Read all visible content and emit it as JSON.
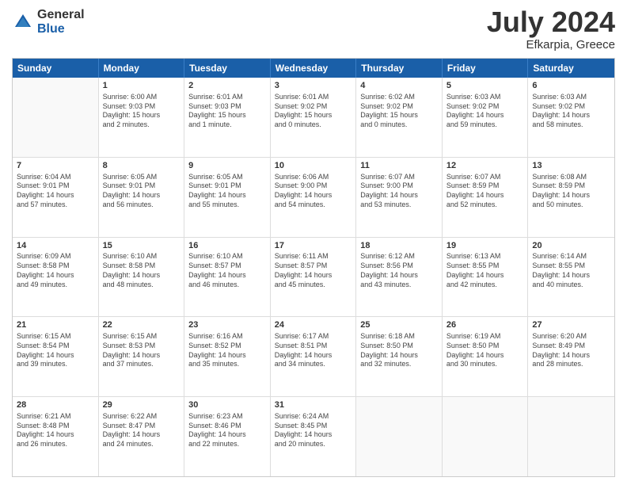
{
  "logo": {
    "general": "General",
    "blue": "Blue"
  },
  "title": {
    "month": "July 2024",
    "location": "Efkarpia, Greece"
  },
  "header": {
    "days": [
      "Sunday",
      "Monday",
      "Tuesday",
      "Wednesday",
      "Thursday",
      "Friday",
      "Saturday"
    ]
  },
  "weeks": [
    [
      {
        "day": "",
        "info": ""
      },
      {
        "day": "1",
        "info": "Sunrise: 6:00 AM\nSunset: 9:03 PM\nDaylight: 15 hours\nand 2 minutes."
      },
      {
        "day": "2",
        "info": "Sunrise: 6:01 AM\nSunset: 9:03 PM\nDaylight: 15 hours\nand 1 minute."
      },
      {
        "day": "3",
        "info": "Sunrise: 6:01 AM\nSunset: 9:02 PM\nDaylight: 15 hours\nand 0 minutes."
      },
      {
        "day": "4",
        "info": "Sunrise: 6:02 AM\nSunset: 9:02 PM\nDaylight: 15 hours\nand 0 minutes."
      },
      {
        "day": "5",
        "info": "Sunrise: 6:03 AM\nSunset: 9:02 PM\nDaylight: 14 hours\nand 59 minutes."
      },
      {
        "day": "6",
        "info": "Sunrise: 6:03 AM\nSunset: 9:02 PM\nDaylight: 14 hours\nand 58 minutes."
      }
    ],
    [
      {
        "day": "7",
        "info": "Sunrise: 6:04 AM\nSunset: 9:01 PM\nDaylight: 14 hours\nand 57 minutes."
      },
      {
        "day": "8",
        "info": "Sunrise: 6:05 AM\nSunset: 9:01 PM\nDaylight: 14 hours\nand 56 minutes."
      },
      {
        "day": "9",
        "info": "Sunrise: 6:05 AM\nSunset: 9:01 PM\nDaylight: 14 hours\nand 55 minutes."
      },
      {
        "day": "10",
        "info": "Sunrise: 6:06 AM\nSunset: 9:00 PM\nDaylight: 14 hours\nand 54 minutes."
      },
      {
        "day": "11",
        "info": "Sunrise: 6:07 AM\nSunset: 9:00 PM\nDaylight: 14 hours\nand 53 minutes."
      },
      {
        "day": "12",
        "info": "Sunrise: 6:07 AM\nSunset: 8:59 PM\nDaylight: 14 hours\nand 52 minutes."
      },
      {
        "day": "13",
        "info": "Sunrise: 6:08 AM\nSunset: 8:59 PM\nDaylight: 14 hours\nand 50 minutes."
      }
    ],
    [
      {
        "day": "14",
        "info": "Sunrise: 6:09 AM\nSunset: 8:58 PM\nDaylight: 14 hours\nand 49 minutes."
      },
      {
        "day": "15",
        "info": "Sunrise: 6:10 AM\nSunset: 8:58 PM\nDaylight: 14 hours\nand 48 minutes."
      },
      {
        "day": "16",
        "info": "Sunrise: 6:10 AM\nSunset: 8:57 PM\nDaylight: 14 hours\nand 46 minutes."
      },
      {
        "day": "17",
        "info": "Sunrise: 6:11 AM\nSunset: 8:57 PM\nDaylight: 14 hours\nand 45 minutes."
      },
      {
        "day": "18",
        "info": "Sunrise: 6:12 AM\nSunset: 8:56 PM\nDaylight: 14 hours\nand 43 minutes."
      },
      {
        "day": "19",
        "info": "Sunrise: 6:13 AM\nSunset: 8:55 PM\nDaylight: 14 hours\nand 42 minutes."
      },
      {
        "day": "20",
        "info": "Sunrise: 6:14 AM\nSunset: 8:55 PM\nDaylight: 14 hours\nand 40 minutes."
      }
    ],
    [
      {
        "day": "21",
        "info": "Sunrise: 6:15 AM\nSunset: 8:54 PM\nDaylight: 14 hours\nand 39 minutes."
      },
      {
        "day": "22",
        "info": "Sunrise: 6:15 AM\nSunset: 8:53 PM\nDaylight: 14 hours\nand 37 minutes."
      },
      {
        "day": "23",
        "info": "Sunrise: 6:16 AM\nSunset: 8:52 PM\nDaylight: 14 hours\nand 35 minutes."
      },
      {
        "day": "24",
        "info": "Sunrise: 6:17 AM\nSunset: 8:51 PM\nDaylight: 14 hours\nand 34 minutes."
      },
      {
        "day": "25",
        "info": "Sunrise: 6:18 AM\nSunset: 8:50 PM\nDaylight: 14 hours\nand 32 minutes."
      },
      {
        "day": "26",
        "info": "Sunrise: 6:19 AM\nSunset: 8:50 PM\nDaylight: 14 hours\nand 30 minutes."
      },
      {
        "day": "27",
        "info": "Sunrise: 6:20 AM\nSunset: 8:49 PM\nDaylight: 14 hours\nand 28 minutes."
      }
    ],
    [
      {
        "day": "28",
        "info": "Sunrise: 6:21 AM\nSunset: 8:48 PM\nDaylight: 14 hours\nand 26 minutes."
      },
      {
        "day": "29",
        "info": "Sunrise: 6:22 AM\nSunset: 8:47 PM\nDaylight: 14 hours\nand 24 minutes."
      },
      {
        "day": "30",
        "info": "Sunrise: 6:23 AM\nSunset: 8:46 PM\nDaylight: 14 hours\nand 22 minutes."
      },
      {
        "day": "31",
        "info": "Sunrise: 6:24 AM\nSunset: 8:45 PM\nDaylight: 14 hours\nand 20 minutes."
      },
      {
        "day": "",
        "info": ""
      },
      {
        "day": "",
        "info": ""
      },
      {
        "day": "",
        "info": ""
      }
    ]
  ]
}
